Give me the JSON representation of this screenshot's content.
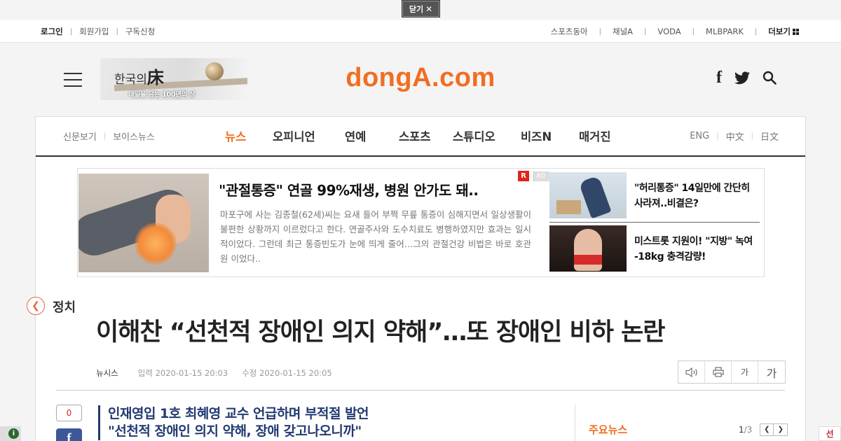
{
  "close_bar": {
    "label": "닫기",
    "icon": "close-icon"
  },
  "utility": {
    "left": [
      "로그인",
      "회원가입",
      "구독신청"
    ],
    "right": [
      "스포츠동아",
      "채널A",
      "VODA",
      "MLBPARK"
    ],
    "more_label": "더보기"
  },
  "header": {
    "promo_title_a": "한국의",
    "promo_title_b": "床",
    "promo_subtitle": "내일을 담는 100년의 상",
    "logo": "dongA.com"
  },
  "gnb": {
    "left": [
      "신문보기",
      "보이스뉴스"
    ],
    "center": [
      "뉴스",
      "오피니언",
      "연예",
      "스포츠",
      "스튜디오",
      "비즈N",
      "매거진"
    ],
    "active_index": 0,
    "right": [
      "ENG",
      "中文",
      "日文"
    ]
  },
  "ad": {
    "title": "\"관절통증\" 연골 99%재생, 병원 안가도 돼..",
    "description": "마포구에 사는 김종철(62세)씨는 요새 들어 부쩍 무릎 통증이 심해지면서 일상생활이 불편한 상황까지 이르렀다고 한다. 연골주사와 도수치료도 병행하였지만 효과는 일시적이었다. 그런데 최근 통증빈도가 눈에 띄게 줄어…그의 관절건강 비법은 바로 호관원 이었다..",
    "badge_r": "R",
    "badge_ad": "AD",
    "side": [
      {
        "text": "\"허리통증\" 14일만에 간단히 사라져..비결은?"
      },
      {
        "text": "미스트롯 지원이! \"지방\" 녹여 -18kg 충격감량!"
      }
    ]
  },
  "article": {
    "section": "정치",
    "headline": "이해찬 “선천적 장애인 의지 약해”…또 장애인 비하 논란",
    "source": "뉴시스",
    "published": "입력 2020-01-15 20:03",
    "updated": "수정 2020-01-15 20:05",
    "tools": {
      "font_small": "가",
      "font_large": "가"
    },
    "comment_count": "0",
    "facebook_label": "f",
    "subheads": [
      "인재영입 1호 최혜영 교수 언급하며 부적절 발언",
      "\"선천적 장애인 의지 약해, 장애 갖고나오니까\""
    ]
  },
  "sidebar": {
    "title": "주요뉴스",
    "page_current": "1",
    "page_total": "/3"
  },
  "colors": {
    "accent": "#f26d21",
    "subhead": "#223a72",
    "facebook": "#3b5998",
    "ad_badge": "#e2231a"
  }
}
